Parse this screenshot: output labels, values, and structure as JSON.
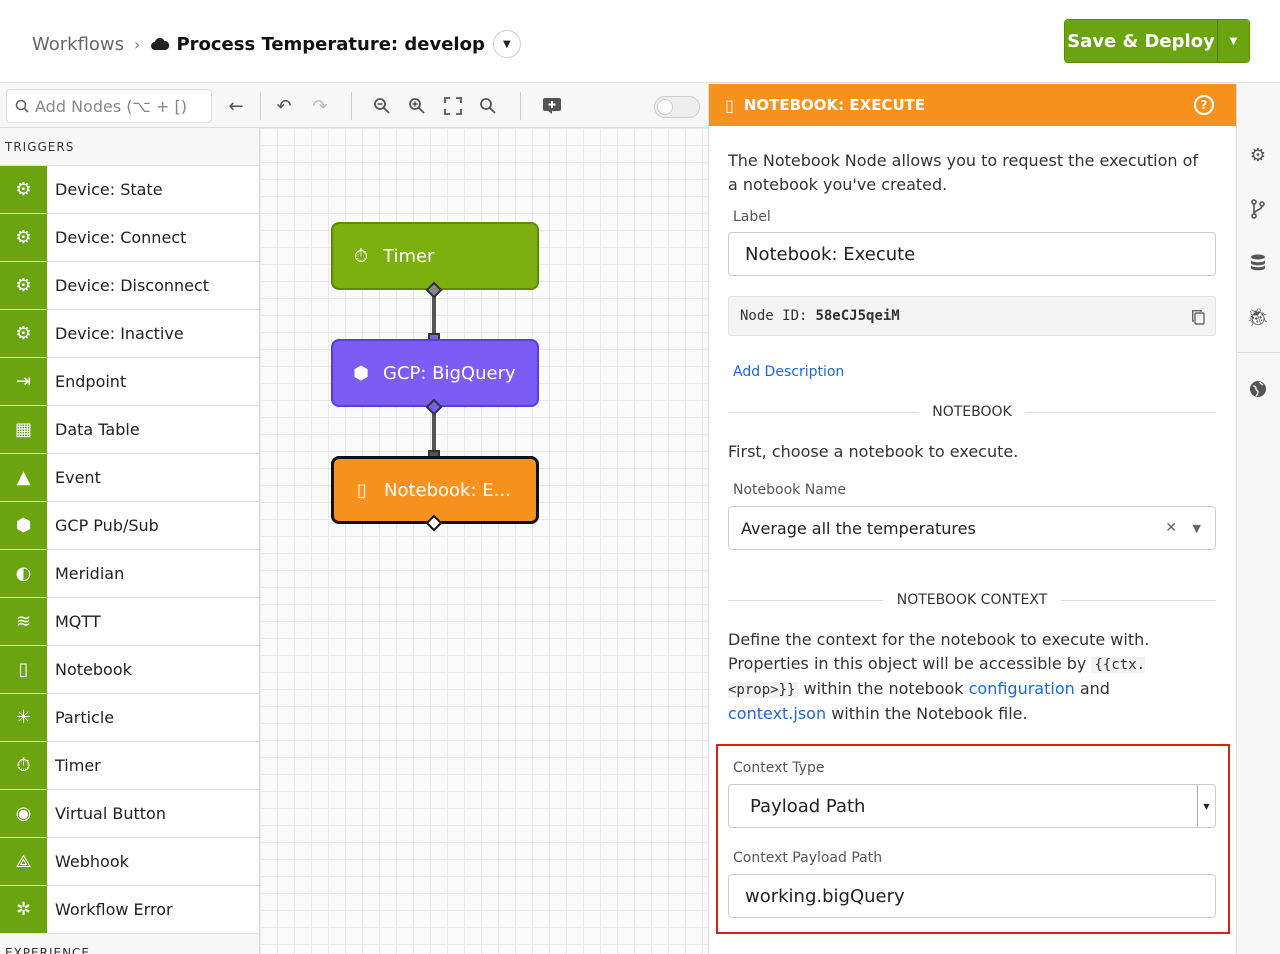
{
  "breadcrumb": {
    "root": "Workflows",
    "separator": "›",
    "title": "Process Temperature: develop"
  },
  "deploy": {
    "label": "Save & Deploy"
  },
  "toolbar": {
    "search_placeholder": "Add Nodes (⌥ + [)"
  },
  "sidebar": {
    "section": "TRIGGERS",
    "items": [
      {
        "label": "Device: State",
        "icon": "chip-icon"
      },
      {
        "label": "Device: Connect",
        "icon": "chip-icon"
      },
      {
        "label": "Device: Disconnect",
        "icon": "chip-icon"
      },
      {
        "label": "Device: Inactive",
        "icon": "chip-icon"
      },
      {
        "label": "Endpoint",
        "icon": "endpoint-icon"
      },
      {
        "label": "Data Table",
        "icon": "table-icon"
      },
      {
        "label": "Event",
        "icon": "warning-icon"
      },
      {
        "label": "GCP Pub/Sub",
        "icon": "gcp-icon"
      },
      {
        "label": "Meridian",
        "icon": "meridian-icon"
      },
      {
        "label": "MQTT",
        "icon": "mqtt-icon"
      },
      {
        "label": "Notebook",
        "icon": "notebook-icon"
      },
      {
        "label": "Particle",
        "icon": "particle-icon"
      },
      {
        "label": "Timer",
        "icon": "timer-icon"
      },
      {
        "label": "Virtual Button",
        "icon": "button-icon"
      },
      {
        "label": "Webhook",
        "icon": "webhook-icon"
      },
      {
        "label": "Workflow Error",
        "icon": "error-icon"
      }
    ],
    "next_section": "EXPERIENCE"
  },
  "canvas": {
    "nodes": [
      {
        "label": "Timer",
        "icon": "timer-icon",
        "color": "#7cb00e"
      },
      {
        "label": "GCP: BigQuery",
        "icon": "bigquery-icon",
        "color": "#7b5cf5"
      },
      {
        "label": "Notebook: E...",
        "icon": "notebook-icon",
        "color": "#f8921e"
      }
    ]
  },
  "panel": {
    "title": "NOTEBOOK: EXECUTE",
    "intro": "The Notebook Node allows you to request the execution of a notebook you've created.",
    "label_field": {
      "label": "Label",
      "value": "Notebook: Execute"
    },
    "node_id": {
      "label": "Node ID:",
      "value": "58eCJ5qeiM"
    },
    "add_description": "Add Description",
    "section_notebook": "NOTEBOOK",
    "notebook_intro": "First, choose a notebook to execute.",
    "notebook_name": {
      "label": "Notebook Name",
      "value": "Average all the temperatures"
    },
    "section_context": "NOTEBOOK CONTEXT",
    "context_desc": {
      "p1": "Define the context for the notebook to execute with. Properties in this object will be accessible by ",
      "code": "{{ctx.<prop>}}",
      "p2": " within the notebook ",
      "link1": "configuration",
      "p3": " and ",
      "link2": "context.json",
      "p4": " within the Notebook file."
    },
    "context_type": {
      "label": "Context Type",
      "value": "Payload Path"
    },
    "context_payload_path": {
      "label": "Context Payload Path",
      "value": "working.bigQuery"
    }
  },
  "colors": {
    "accent_green": "#6aa510",
    "accent_orange": "#f8921e",
    "bigquery_purple": "#7b5cf5",
    "link_blue": "#1a66e8",
    "highlight_red": "#e01b1b"
  }
}
